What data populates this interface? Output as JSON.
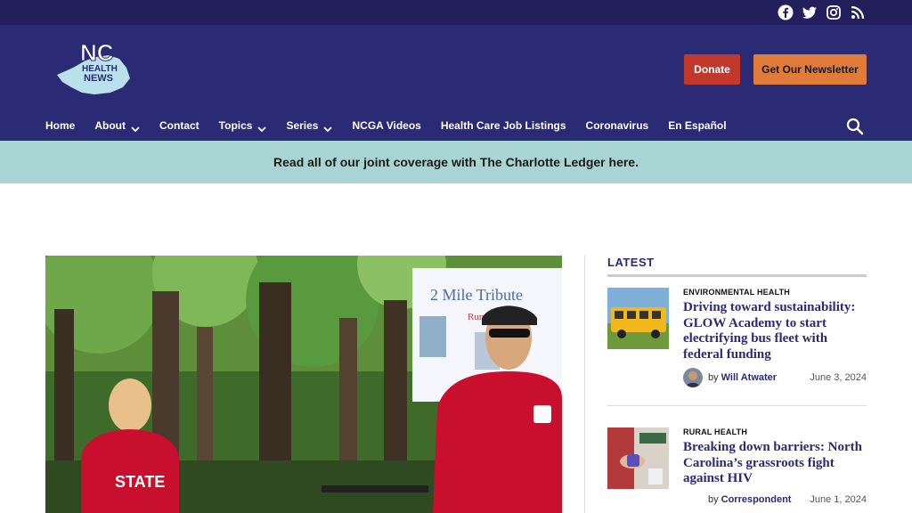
{
  "colors": {
    "primary": "#2b2a74",
    "topbar": "#231f5c",
    "donate": "#c0392b",
    "newsletter": "#e07b39",
    "banner": "#a8d4d3"
  },
  "social": [
    "facebook-icon",
    "twitter-icon",
    "instagram-icon",
    "rss-icon"
  ],
  "logo": {
    "letters": "NC",
    "line1": "HEALTH",
    "line2": "NEWS"
  },
  "header": {
    "donate_label": "Donate",
    "newsletter_label": "Get Our Newsletter"
  },
  "nav": {
    "items": [
      {
        "label": "Home",
        "dropdown": false
      },
      {
        "label": "About",
        "dropdown": true
      },
      {
        "label": "Contact",
        "dropdown": false
      },
      {
        "label": "Topics",
        "dropdown": true
      },
      {
        "label": "Series",
        "dropdown": true
      },
      {
        "label": "NCGA Videos",
        "dropdown": false
      },
      {
        "label": "Health Care Job Listings",
        "dropdown": false
      },
      {
        "label": "Coronavirus",
        "dropdown": false
      },
      {
        "label": "En Español",
        "dropdown": false
      }
    ]
  },
  "banner": {
    "text": "Read all of our joint coverage with The Charlotte Ledger here."
  },
  "hero": {
    "poster_line1": "2 Mile Tribute",
    "poster_line2": "Run/Walk"
  },
  "latest": {
    "heading": "LATEST",
    "articles": [
      {
        "category": "ENVIRONMENTAL HEALTH",
        "title": "Driving toward sustainability: GLOW Academy to start electrifying bus fleet with federal funding",
        "by": "by",
        "author": "Will Atwater",
        "date": "June 3, 2024"
      },
      {
        "category": "RURAL HEALTH",
        "title": "Breaking down barriers: North Carolina’s grassroots fight against HIV",
        "by": "by",
        "author": "Correspondent",
        "date": "June 1, 2024"
      }
    ]
  }
}
